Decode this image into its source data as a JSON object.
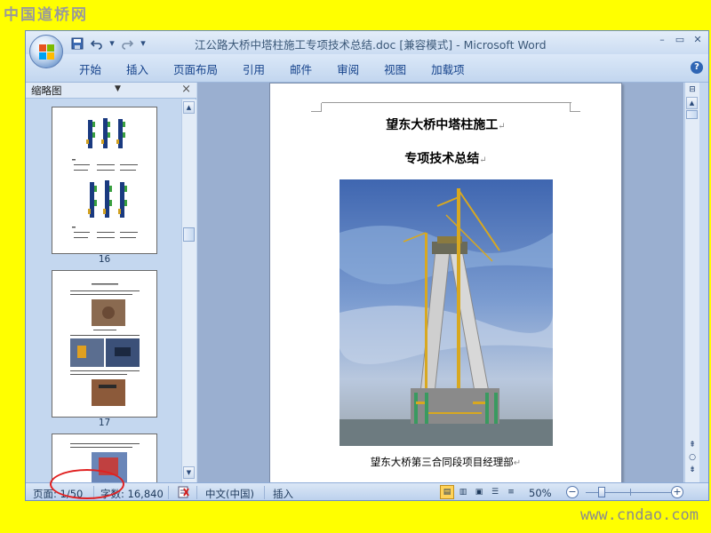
{
  "watermark": {
    "logo": "中国道桥网",
    "url": "www.cndao.com"
  },
  "window": {
    "title": "江公路大桥中塔柱施工专项技术总结.doc [兼容模式] - Microsoft Word"
  },
  "qat": {
    "save": "save",
    "undo": "undo",
    "redo": "redo",
    "customize": "customize"
  },
  "ribbon": {
    "tabs": [
      "开始",
      "插入",
      "页面布局",
      "引用",
      "邮件",
      "审阅",
      "视图",
      "加载项"
    ]
  },
  "thumbnails": {
    "title": "缩略图",
    "pages": [
      {
        "number": "16"
      },
      {
        "number": "17"
      },
      {
        "number": ""
      }
    ]
  },
  "document": {
    "title_line1": "望东大桥中塔柱施工",
    "title_line2": "专项技术总结",
    "paragraph_mark": "↵",
    "caption": "望东大桥第三合同段项目经理部"
  },
  "status": {
    "page": "页面: 1/50",
    "words": "字数: 16,840",
    "language": "中文(中国)",
    "mode": "插入",
    "zoom": "50%",
    "zoom_level": 0.5
  }
}
